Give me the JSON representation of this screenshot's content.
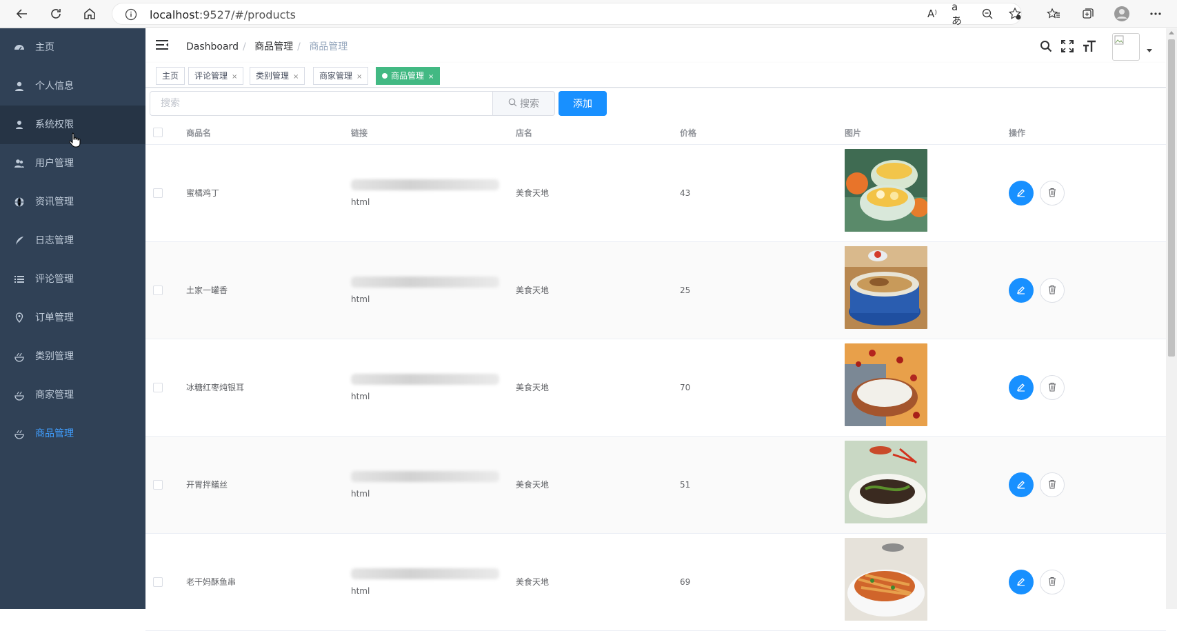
{
  "browser": {
    "url_host": "localhost",
    "url_path": ":9527/#/products"
  },
  "sidebar": {
    "items": [
      {
        "label": "主页",
        "icon": "dashboard-icon"
      },
      {
        "label": "个人信息",
        "icon": "user-icon"
      },
      {
        "label": "系统权限",
        "icon": "user-lock-icon"
      },
      {
        "label": "用户管理",
        "icon": "peoples-icon"
      },
      {
        "label": "资讯管理",
        "icon": "globe-icon"
      },
      {
        "label": "日志管理",
        "icon": "feather-icon"
      },
      {
        "label": "评论管理",
        "icon": "list-icon"
      },
      {
        "label": "订单管理",
        "icon": "location-icon"
      },
      {
        "label": "类别管理",
        "icon": "food-icon"
      },
      {
        "label": "商家管理",
        "icon": "food-icon"
      },
      {
        "label": "商品管理",
        "icon": "food-icon"
      }
    ],
    "active": "商品管理",
    "hovered": "系统权限"
  },
  "navbar": {
    "breadcrumb": [
      "Dashboard",
      "商品管理",
      "商品管理"
    ]
  },
  "tags": [
    {
      "label": "主页",
      "closable": false
    },
    {
      "label": "评论管理",
      "closable": true
    },
    {
      "label": "类别管理",
      "closable": true
    },
    {
      "label": "商家管理",
      "closable": true
    },
    {
      "label": "商品管理",
      "closable": true,
      "active": true
    }
  ],
  "tag_close": "×",
  "toolbar": {
    "search_placeholder": "搜索",
    "search_button": "搜索",
    "add_button": "添加"
  },
  "table": {
    "headers": [
      "商品名",
      "链接",
      "店名",
      "价格",
      "图片",
      "操作"
    ],
    "rows": [
      {
        "name": "蜜橘鸡丁",
        "link_tail": "html",
        "shop": "美食天地",
        "price": "43",
        "img": "fruit-bowl"
      },
      {
        "name": "土家一罐香",
        "link_tail": "html",
        "shop": "美食天地",
        "price": "25",
        "img": "clay-pot"
      },
      {
        "name": "冰糖红枣炖银耳",
        "link_tail": "html",
        "shop": "美食天地",
        "price": "70",
        "img": "rice-dates"
      },
      {
        "name": "开胃拌鳝丝",
        "link_tail": "html",
        "shop": "美食天地",
        "price": "51",
        "img": "eel-dish"
      },
      {
        "name": "老干妈酥鱼串",
        "link_tail": "html",
        "shop": "美食天地",
        "price": "69",
        "img": "fish-skewer"
      }
    ]
  },
  "colors": {
    "sidebar_bg": "#304156",
    "sidebar_text": "#bfcbd9",
    "active_text": "#409eff",
    "primary": "#1890ff",
    "tag_active": "#42b983"
  }
}
